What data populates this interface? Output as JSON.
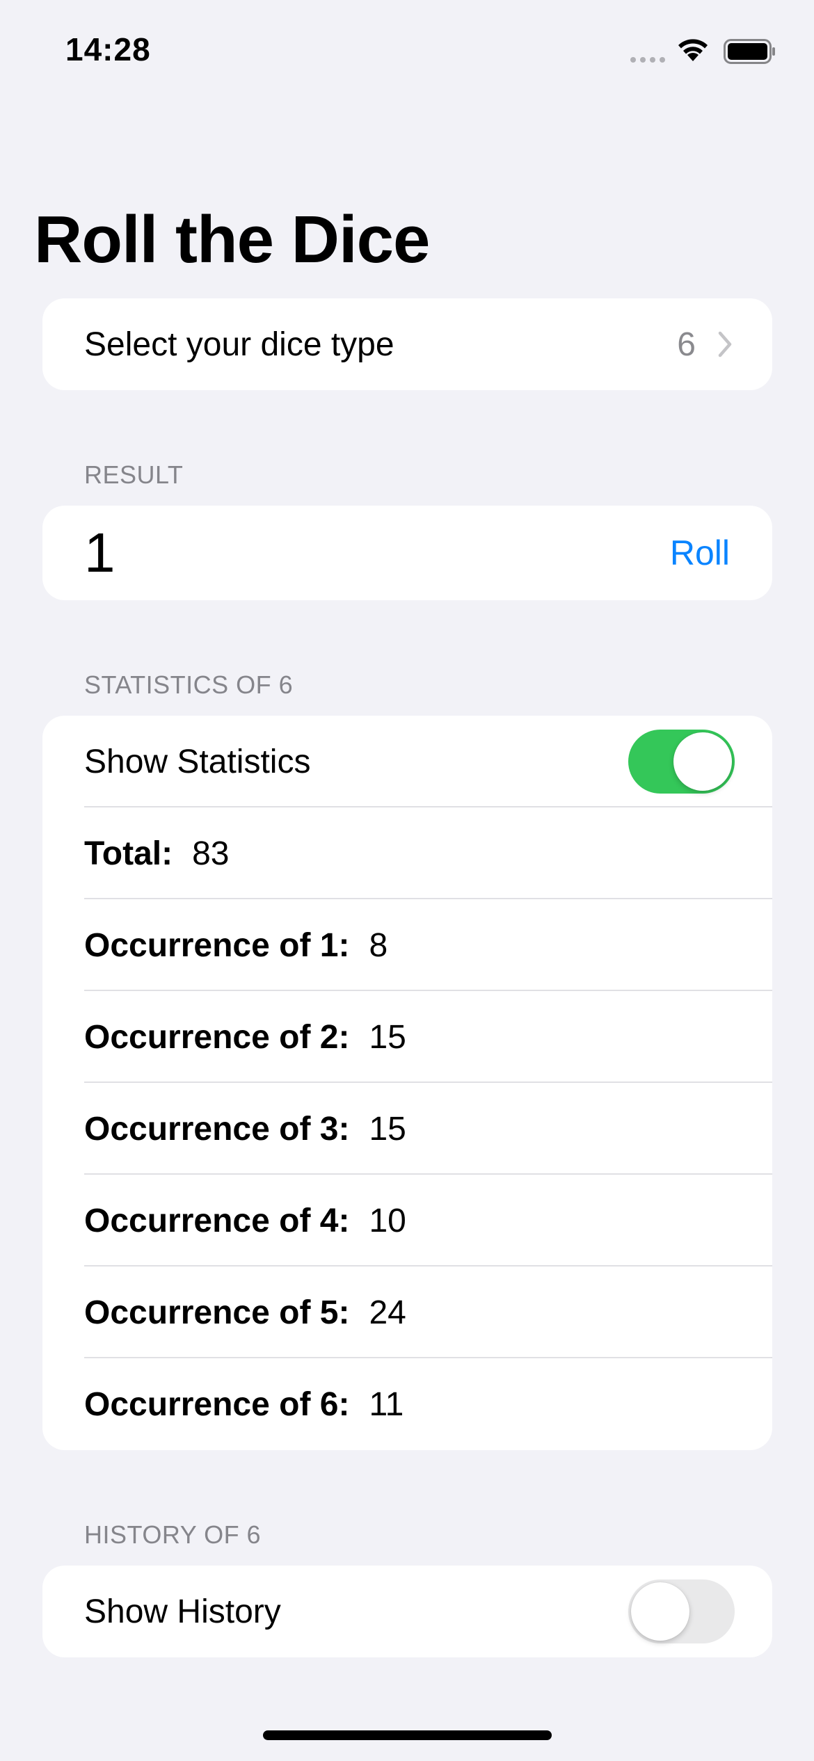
{
  "status_bar": {
    "time": "14:28"
  },
  "title": "Roll the Dice",
  "dice_type": {
    "label": "Select your dice type",
    "value": "6"
  },
  "result_section": {
    "header": "RESULT",
    "value": "1",
    "roll_label": "Roll"
  },
  "statistics": {
    "header": "STATISTICS OF 6",
    "toggle_label": "Show Statistics",
    "toggle_on": true,
    "total_label": "Total:",
    "total_value": "83",
    "occurrences": [
      {
        "label": "Occurrence of 1:",
        "value": "8"
      },
      {
        "label": "Occurrence of 2:",
        "value": "15"
      },
      {
        "label": "Occurrence of 3:",
        "value": "15"
      },
      {
        "label": "Occurrence of 4:",
        "value": "10"
      },
      {
        "label": "Occurrence of 5:",
        "value": "24"
      },
      {
        "label": "Occurrence of 6:",
        "value": "11"
      }
    ]
  },
  "history": {
    "header": "HISTORY OF 6",
    "toggle_label": "Show History",
    "toggle_on": false
  },
  "colors": {
    "accent": "#0a84ff",
    "toggle_on": "#34c759",
    "background": "#f2f2f7"
  }
}
